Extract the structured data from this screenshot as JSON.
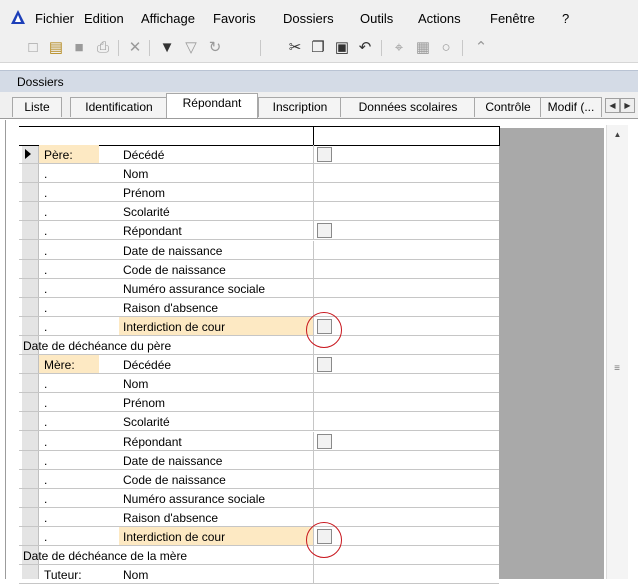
{
  "menubar": {
    "items": [
      "Fichier",
      "Edition",
      "Affichage",
      "Favoris",
      "Dossiers",
      "Outils",
      "Actions",
      "Fenêtre",
      "?"
    ]
  },
  "toolbar": {
    "icons": [
      "new-icon",
      "open-folder-icon",
      "save-icon",
      "print-icon",
      "delete-icon",
      "filter-icon",
      "funnel-icon",
      "refresh-icon",
      "cut-icon",
      "copy-icon",
      "paste-icon",
      "undo-icon",
      "frame-icon",
      "book-icon",
      "search-replace-icon",
      "up-arrow-icon"
    ]
  },
  "panel": {
    "title": "Dossiers"
  },
  "tabs": [
    {
      "label": "Liste"
    },
    {
      "label": "Identification"
    },
    {
      "label": "Répondant",
      "active": true
    },
    {
      "label": "Inscription"
    },
    {
      "label": "Données scolaires"
    },
    {
      "label": "Contrôle"
    },
    {
      "label": "Modif (..."
    }
  ],
  "colors": {
    "highlight": "#fde9c3",
    "circle": "#c8161d",
    "panel_header": "#d4dbe6",
    "grid_gray": "#a9a9a9"
  },
  "rows": [
    {
      "c1": "Père:",
      "c2": "Décédé",
      "check": true,
      "highlight_c1": true,
      "current": true
    },
    {
      "c1": ".",
      "c2": "Nom"
    },
    {
      "c1": ".",
      "c2": "Prénom"
    },
    {
      "c1": ".",
      "c2": "Scolarité"
    },
    {
      "c1": ".",
      "c2": "Répondant",
      "check": true
    },
    {
      "c1": ".",
      "c2": "Date de naissance"
    },
    {
      "c1": ".",
      "c2": "Code de naissance"
    },
    {
      "c1": ".",
      "c2": "Numéro assurance sociale"
    },
    {
      "c1": ".",
      "c2": "Raison d'absence"
    },
    {
      "c1": ".",
      "c2": "Interdiction de cour",
      "check": true,
      "highlight_c2": true,
      "circled": true
    },
    {
      "c1": "",
      "c2": "Date de déchéance du père",
      "wide": true
    },
    {
      "c1": "Mère:",
      "c2": "Décédée",
      "check": true,
      "highlight_c1": true
    },
    {
      "c1": ".",
      "c2": "Nom"
    },
    {
      "c1": ".",
      "c2": "Prénom"
    },
    {
      "c1": ".",
      "c2": "Scolarité"
    },
    {
      "c1": ".",
      "c2": "Répondant",
      "check": true
    },
    {
      "c1": ".",
      "c2": "Date de naissance"
    },
    {
      "c1": ".",
      "c2": "Code de naissance"
    },
    {
      "c1": ".",
      "c2": "Numéro assurance sociale"
    },
    {
      "c1": ".",
      "c2": "Raison d'absence"
    },
    {
      "c1": ".",
      "c2": "Interdiction de cour",
      "check": true,
      "highlight_c2": true,
      "circled": true
    },
    {
      "c1": "",
      "c2": "Date de déchéance de la mère",
      "wide": true
    },
    {
      "c1": "Tuteur:",
      "c2": "Nom"
    }
  ]
}
